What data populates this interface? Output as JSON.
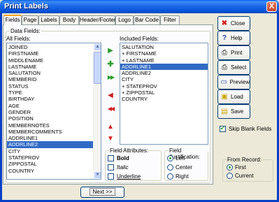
{
  "window": {
    "title": "Print Labels",
    "close_glyph": "X"
  },
  "tabs": [
    {
      "label": "Fields",
      "active": true
    },
    {
      "label": "Page"
    },
    {
      "label": "Labels"
    },
    {
      "label": "Body"
    },
    {
      "label": "Header/Footer"
    },
    {
      "label": "Logo"
    },
    {
      "label": "Bar Code"
    },
    {
      "label": "Filter"
    }
  ],
  "data_fields": {
    "legend": "Data Fields:",
    "all_fields_label": "All Fields:",
    "all_fields": [
      "JOINED",
      "FIRSTNAME",
      "MIDDLENAME",
      "LASTNAME",
      "SALUTATION",
      "MEMBERID",
      "STATUS",
      "TYPE",
      "BIRTHDAY",
      "AGE",
      "GENDER",
      "POSITION",
      "MEMBERNOTES",
      "MEMBERCOMMENTS",
      "ADDRLINE1",
      "ADDRLINE2",
      "CITY",
      "STATEPROV",
      "ZIPPOSTAL",
      "COUNTRY"
    ],
    "all_fields_selected": "ADDRLINE2",
    "included_label": "Included Fields:",
    "included_fields": [
      "SALUTATION",
      "+ FIRSTNAME",
      "+ LASTNAME",
      "ADDRLINE1",
      "ADDRLINE2",
      "CITY",
      "+ STATEPROV",
      "+ ZIPPOSTAL",
      "COUNTRY"
    ],
    "included_selected": "ADDRLINE1"
  },
  "arrow_buttons": [
    {
      "name": "add-field-button",
      "glyph": "▶",
      "color": "#2a9d2a"
    },
    {
      "name": "add-plus-button",
      "glyph": "✚",
      "color": "#2a9d2a"
    },
    {
      "name": "add-all-button",
      "glyph": "▶▶",
      "color": "#2a9d2a"
    },
    {
      "name": "remove-field-button",
      "glyph": "◀",
      "color": "#d02020"
    },
    {
      "name": "remove-all-button",
      "glyph": "◀◀",
      "color": "#d02020"
    },
    {
      "name": "move-up-button",
      "glyph": "▲",
      "color": "#d02020"
    },
    {
      "name": "move-down-button",
      "glyph": "▼",
      "color": "#d02020"
    }
  ],
  "field_attributes": {
    "legend": "Field Attributes:",
    "bold": "Bold",
    "italic": "Italic",
    "underline": "Underline"
  },
  "field_justification": {
    "legend": "Field Justification:",
    "options": [
      "Left",
      "Center",
      "Right"
    ],
    "selected": "Left"
  },
  "side_buttons": [
    {
      "label": "Close",
      "icon": "✖",
      "color": "#d02020"
    },
    {
      "label": "Help",
      "icon": "?",
      "color": "#1a3fa0"
    },
    {
      "label": "Print",
      "icon": "⎙",
      "color": "#333333"
    },
    {
      "label": "Select",
      "icon": "⎙",
      "color": "#333333"
    },
    {
      "label": "Preview",
      "icon": "▭",
      "color": "#1a3fa0"
    },
    {
      "label": "Load",
      "icon": "▣",
      "color": "#c9a400"
    },
    {
      "label": "Save",
      "icon": "▤",
      "color": "#c9a400"
    }
  ],
  "skip_blank_fields": {
    "label": "Skip Blank Fields",
    "checked": true
  },
  "from_record": {
    "legend": "From Record:",
    "options": [
      "First",
      "Current"
    ],
    "selected": "First"
  },
  "next_button": "Next >>"
}
